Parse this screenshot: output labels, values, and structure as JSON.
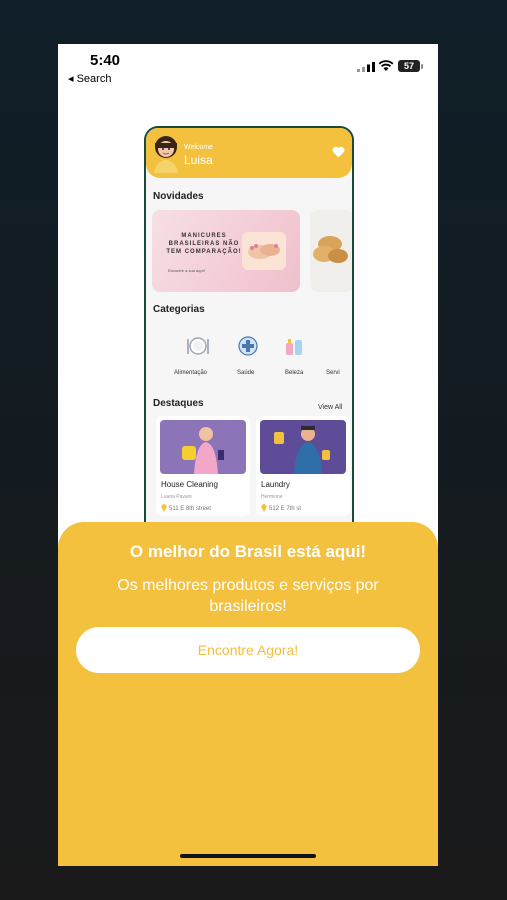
{
  "status_bar": {
    "time": "5:40",
    "back_label": "◂ Search",
    "battery": "57"
  },
  "mockup": {
    "welcome_label": "Welcome",
    "user_name": "Luisa",
    "novidades_title": "Novidades",
    "banner": {
      "headline": "MANICURES BRASILEIRAS NÃO TEM COMPARAÇÃO!",
      "subtext": "Encontre a sua aqui!"
    },
    "categorias_title": "Categorias",
    "categories": [
      {
        "label": "Alimentação",
        "icon": "plate-icon"
      },
      {
        "label": "Saúde",
        "icon": "health-icon"
      },
      {
        "label": "Beleza",
        "icon": "beauty-icon"
      },
      {
        "label": "Servi",
        "icon": "service-icon"
      }
    ],
    "destaques_title": "Destaques",
    "view_all": "View All",
    "cards": [
      {
        "title": "House Cleaning",
        "provider": "Luana Pavani",
        "location": "511 E 8th street"
      },
      {
        "title": "Laundry",
        "provider": "Hermione",
        "location": "512 E 7th st"
      }
    ]
  },
  "sheet": {
    "title": "O melhor do Brasil está aqui!",
    "subtitle": "Os melhores produtos e serviços por brasileiros!",
    "cta_label": "Encontre Agora!"
  },
  "colors": {
    "accent": "#f4c13f",
    "mockup_border": "#1a4a3e",
    "card_image_bg": "#8b74b8"
  }
}
